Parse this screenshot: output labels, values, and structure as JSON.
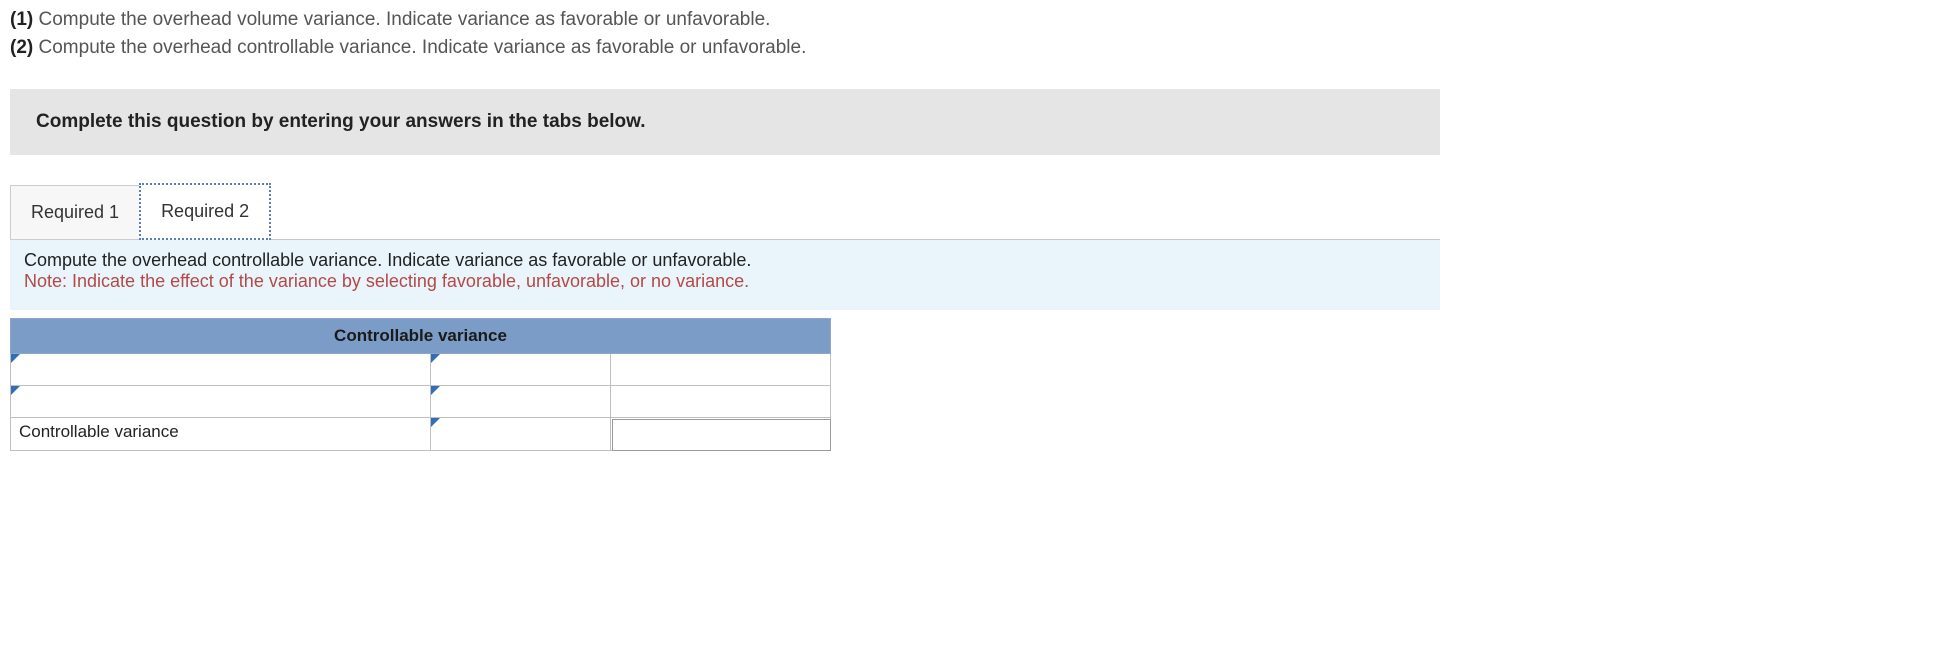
{
  "questions": [
    {
      "num": "(1)",
      "text": "Compute the overhead volume variance. Indicate variance as favorable or unfavorable."
    },
    {
      "num": "(2)",
      "text": "Compute the overhead controllable variance. Indicate variance as favorable or unfavorable."
    }
  ],
  "instruction": "Complete this question by entering your answers in the tabs below.",
  "tabs": [
    {
      "label": "Required 1"
    },
    {
      "label": "Required 2"
    }
  ],
  "panel": {
    "line1": "Compute the overhead controllable variance. Indicate variance as favorable or unfavorable.",
    "note": "Note: Indicate the effect of the variance by selecting favorable, unfavorable, or no variance."
  },
  "table": {
    "header": "Controllable variance",
    "footer_label": "Controllable variance",
    "rows": [
      {
        "c1": "",
        "c2": "",
        "c3": ""
      },
      {
        "c1": "",
        "c2": "",
        "c3": ""
      }
    ],
    "footer": {
      "c2": "",
      "c3": ""
    }
  }
}
